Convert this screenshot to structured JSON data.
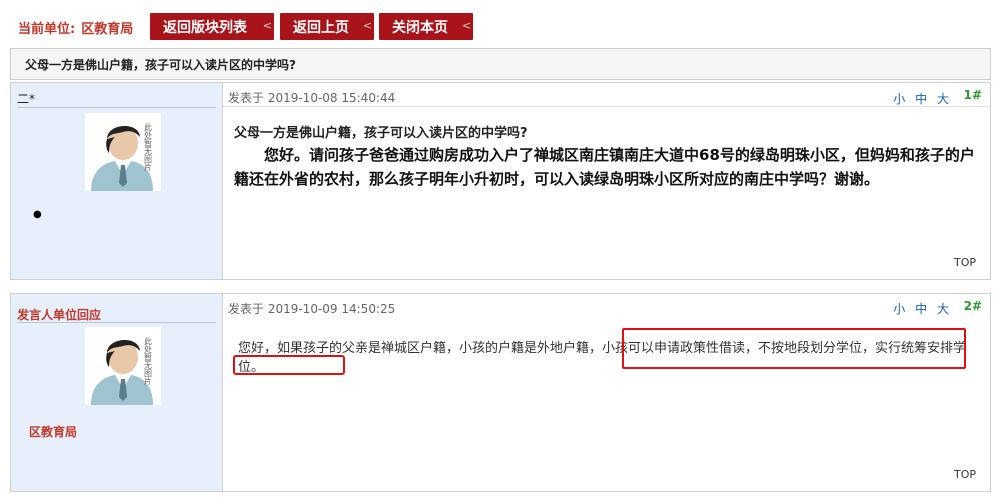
{
  "header": {
    "unit_label": "当前单位:",
    "unit_value": "区教育局",
    "buttons": {
      "back_list": "返回版块列表",
      "back_prev": "返回上页",
      "close": "关闭本页"
    }
  },
  "thread": {
    "title": "父母一方是佛山户籍，孩子可以入读片区的中学吗?"
  },
  "posts": [
    {
      "author": "二*",
      "avatar_caption": "此处暂无图片",
      "date": "发表于 2019-10-08 15:40:44",
      "font_sizes": [
        "小",
        "中",
        "大"
      ],
      "floor": "1#",
      "title": "父母一方是佛山户籍，孩子可以入读片区的中学吗?",
      "body": "您好。请问孩子爸爸通过购房成功入户了禅城区南庄镇南庄大道中68号的绿岛明珠小区，但妈妈和孩子的户籍还在外省的农村，那么孩子明年小升初时，可以入读绿岛明珠小区所对应的南庄中学吗？谢谢。",
      "top": "TOP"
    },
    {
      "author": "发言人单位回应",
      "avatar_caption": "此处暂无图片",
      "org": "区教育局",
      "date": "发表于 2019-10-09 14:50:25",
      "font_sizes": [
        "小",
        "中",
        "大"
      ],
      "floor": "2#",
      "body": "您好，如果孩子的父亲是禅城区户籍，小孩的户籍是外地户籍，小孩可以申请政策性借读，不按地段划分学位，实行统筹安排学位。",
      "top": "TOP"
    }
  ]
}
